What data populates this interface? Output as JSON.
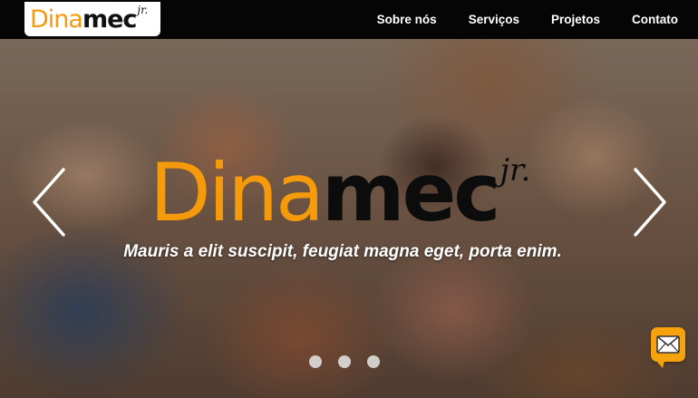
{
  "header": {
    "logo": {
      "part1": "Dina",
      "part2": "mec",
      "suffix": "jr."
    },
    "nav": [
      {
        "label": "Sobre nós"
      },
      {
        "label": "Serviços"
      },
      {
        "label": "Projetos"
      },
      {
        "label": "Contato"
      }
    ]
  },
  "hero": {
    "logo": {
      "part1": "Dina",
      "part2": "mec",
      "suffix": "jr."
    },
    "tagline": "Mauris a elit suscipit, feugiat magna eget, porta enim.",
    "slide_count": 3,
    "prev_icon": "chevron-left-icon",
    "next_icon": "chevron-right-icon"
  },
  "contact_widget": {
    "icon": "envelope-icon"
  },
  "colors": {
    "brand_orange": "#f59a0a",
    "navbar_bg": "#050505",
    "text_white": "#ffffff"
  }
}
